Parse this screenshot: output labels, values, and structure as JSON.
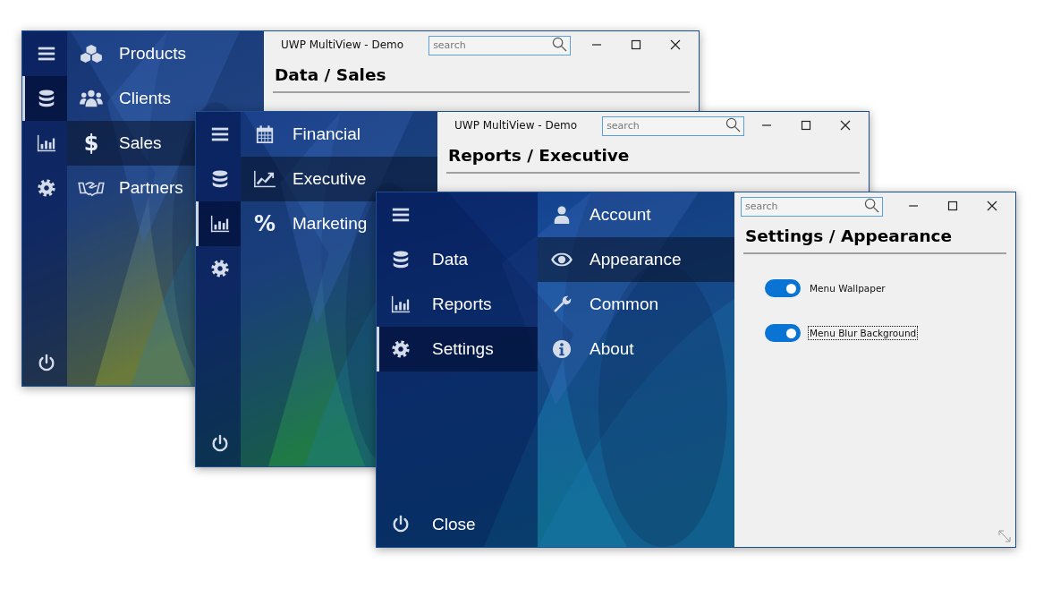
{
  "windows": [
    {
      "title": "UWP MultiView - Demo",
      "search": {
        "placeholder": "search"
      },
      "rail": {
        "expanded": false,
        "items": [
          {
            "kind": "menu",
            "selected": false
          },
          {
            "kind": "data",
            "selected": true
          },
          {
            "kind": "reports",
            "selected": false
          },
          {
            "kind": "settings",
            "selected": false
          }
        ]
      },
      "nav": [
        {
          "kind": "cubes",
          "label": "Products",
          "selected": false
        },
        {
          "kind": "people",
          "label": "Clients",
          "selected": false
        },
        {
          "kind": "glyph",
          "glyph": "$",
          "label": "Sales",
          "selected": true
        },
        {
          "kind": "handshake",
          "label": "Partners",
          "selected": false
        }
      ],
      "heading": "Data / Sales"
    },
    {
      "title": "UWP MultiView - Demo",
      "search": {
        "placeholder": "search"
      },
      "rail": {
        "expanded": false,
        "items": [
          {
            "kind": "menu",
            "selected": false
          },
          {
            "kind": "data",
            "selected": false
          },
          {
            "kind": "reports",
            "selected": true
          },
          {
            "kind": "settings",
            "selected": false
          }
        ]
      },
      "nav": [
        {
          "kind": "calendar",
          "label": "Financial",
          "selected": false
        },
        {
          "kind": "trend",
          "label": "Executive",
          "selected": true
        },
        {
          "kind": "glyph",
          "glyph": "%",
          "label": "Marketing",
          "selected": false
        }
      ],
      "heading": "Reports / Executive"
    },
    {
      "search": {
        "placeholder": "search"
      },
      "rail": {
        "expanded": true,
        "items": [
          {
            "kind": "menu",
            "selected": false
          },
          {
            "kind": "data",
            "label": "Data",
            "selected": false
          },
          {
            "kind": "reports",
            "label": "Reports",
            "selected": false
          },
          {
            "kind": "settings",
            "label": "Settings",
            "selected": true
          }
        ],
        "exit_label": "Close"
      },
      "nav": [
        {
          "kind": "user",
          "label": "Account",
          "selected": false
        },
        {
          "kind": "eye",
          "label": "Appearance",
          "selected": true
        },
        {
          "kind": "wrench",
          "label": "Common",
          "selected": false
        },
        {
          "kind": "info",
          "label": "About",
          "selected": false
        }
      ],
      "heading": "Settings / Appearance",
      "toggles": [
        {
          "label": "Menu Wallpaper",
          "on": true,
          "focused": false
        },
        {
          "label": "Menu Blur Background",
          "on": true,
          "focused": true
        }
      ]
    }
  ]
}
